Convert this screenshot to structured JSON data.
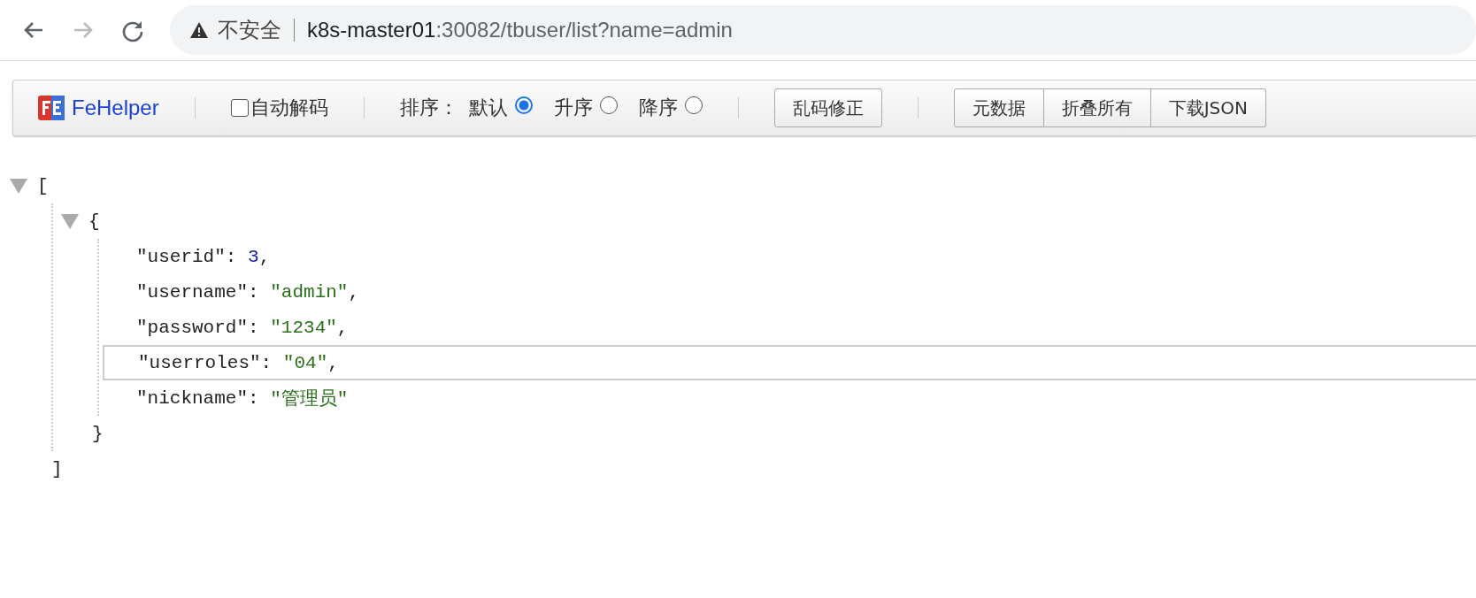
{
  "address_bar": {
    "security": "不安全",
    "host": "k8s-master01",
    "path": ":30082/tbuser/list?name=admin"
  },
  "toolbar": {
    "brand": "FeHelper",
    "auto_decode": {
      "label": "自动解码",
      "checked": false
    },
    "sort_label": "排序：",
    "sort_options": [
      {
        "label": "默认",
        "selected": true
      },
      {
        "label": "升序",
        "selected": false
      },
      {
        "label": "降序",
        "selected": false
      }
    ],
    "fix_button": "乱码修正",
    "buttons": [
      "元数据",
      "折叠所有",
      "下载JSON"
    ]
  },
  "json_view": {
    "open": "[",
    "expanded": true,
    "close": "]",
    "object": {
      "open": "{",
      "expanded": true,
      "close": "}",
      "entries": [
        {
          "key": "\"userid\":",
          "value": "3",
          "kind": "number",
          "comma": ",",
          "selected": false
        },
        {
          "key": "\"username\":",
          "value": "\"admin\"",
          "kind": "string",
          "comma": ",",
          "selected": false
        },
        {
          "key": "\"password\":",
          "value": "\"1234\"",
          "kind": "string",
          "comma": ",",
          "selected": false
        },
        {
          "key": "\"userroles\":",
          "value": "\"04\"",
          "kind": "string",
          "comma": ",",
          "selected": true
        },
        {
          "key": "\"nickname\":",
          "value": "\"管理员\"",
          "kind": "string",
          "selected": false
        }
      ]
    }
  }
}
